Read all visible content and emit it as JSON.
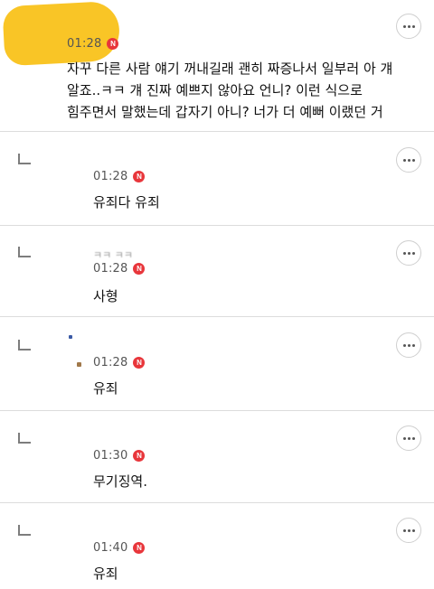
{
  "comments": [
    {
      "time": "01:28",
      "badge": "N",
      "text_lines": [
        "자꾸 다른 사람 얘기 꺼내길래 괜히 짜증나서 일부러 아 걔",
        "알죠..ㅋㅋ 걔 진짜 예쁘지 않아요 언니? 이런 식으로",
        "힘주면서 말했는데 갑자기 아니? 너가 더 예뻐 이랬던 거"
      ]
    }
  ],
  "replies": [
    {
      "time": "01:28",
      "badge": "N",
      "text": "유죄다 유죄"
    },
    {
      "time": "01:28",
      "badge": "N",
      "text": "사형",
      "partial_name": "ㅋㅋ ㅋㅋ"
    },
    {
      "time": "01:28",
      "badge": "N",
      "text": "유죄"
    },
    {
      "time": "01:30",
      "badge": "N",
      "text": "무기징역."
    },
    {
      "time": "01:40",
      "badge": "N",
      "text": "유죄"
    }
  ],
  "icons": {
    "more": "more-options-icon",
    "reply": "reply-arrow-icon",
    "new": "new-badge-icon"
  },
  "colors": {
    "badge": "#e8363b",
    "redaction": "#f9c31f",
    "divider": "#dcdcdc"
  }
}
